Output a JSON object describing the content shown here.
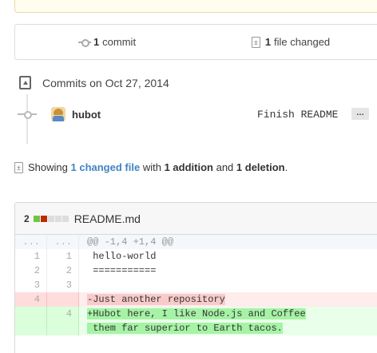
{
  "summary": {
    "commits_count": "1",
    "commits_label": "commit",
    "files_count": "1",
    "files_label": "file changed"
  },
  "commits_section": {
    "header": "Commits on Oct 27, 2014",
    "commit": {
      "author": "hubot",
      "message": "Finish README",
      "ellipsis": "…"
    }
  },
  "showing": {
    "prefix": "Showing",
    "files_link": "1 changed file",
    "with_text": "with",
    "additions": "1 addition",
    "and_text": "and",
    "deletions": "1 deletion",
    "suffix": "."
  },
  "diff": {
    "change_count": "2",
    "filename": "README.md",
    "rows": [
      {
        "type": "hunk",
        "old": "...",
        "new": "...",
        "text": "@@ -1,4 +1,4 @@"
      },
      {
        "type": "ctx",
        "old": "1",
        "new": "1",
        "text": " hello-world"
      },
      {
        "type": "ctx",
        "old": "2",
        "new": "2",
        "text": " ==========="
      },
      {
        "type": "ctx",
        "old": "3",
        "new": "3",
        "text": ""
      },
      {
        "type": "del",
        "old": "4",
        "new": "",
        "text": "-Just another repository"
      },
      {
        "type": "add",
        "old": "",
        "new": "4",
        "text": "+Hubot here, I like Node.js and Coffee"
      },
      {
        "type": "add-cont",
        "old": "",
        "new": "",
        "text": " them far superior to Earth tacos."
      }
    ]
  }
}
